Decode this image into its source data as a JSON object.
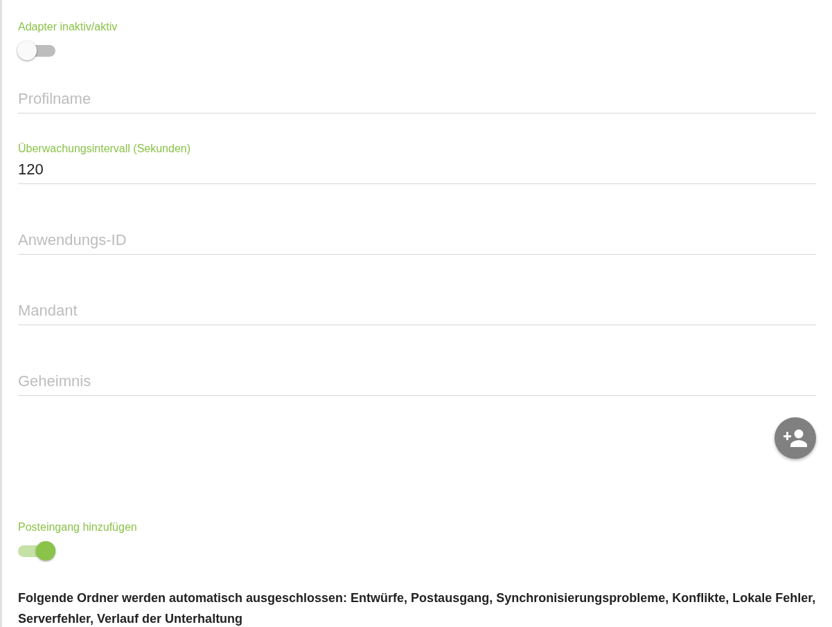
{
  "form": [
    {
      "kind": "toggle",
      "label": "Adapter inaktiv/aktiv",
      "on": false
    },
    {
      "kind": "field",
      "placeholder": "Profilname"
    },
    {
      "kind": "field",
      "label": "Überwachungsintervall (Sekunden)",
      "value": "120"
    },
    {
      "kind": "field",
      "placeholder": "Anwendungs-ID"
    },
    {
      "kind": "field",
      "placeholder": "Mandant"
    },
    {
      "kind": "field",
      "placeholder": "Geheimnis"
    },
    {
      "kind": "fab"
    },
    {
      "kind": "toggle",
      "label": "Posteingang hinzufügen",
      "on": true
    },
    {
      "kind": "note",
      "text": "Folgende Ordner werden automatisch ausgeschlossen: Entwürfe, Postausgang, Synchronisierungsprobleme, Konflikte, Lokale Fehler, Serverfehler, Verlauf der Unterhaltung"
    }
  ]
}
